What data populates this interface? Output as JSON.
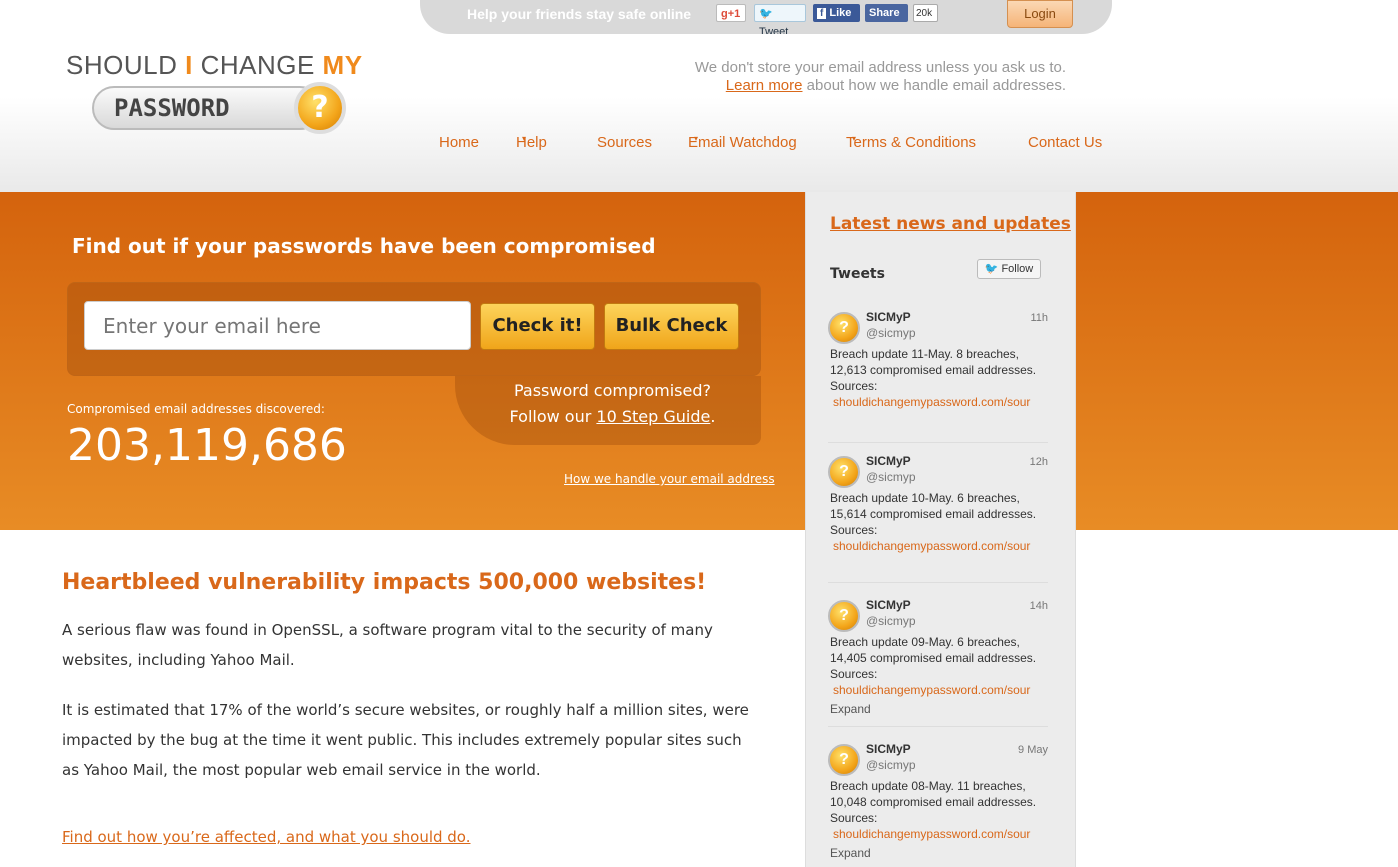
{
  "sharebar": {
    "text": "Help your friends stay safe online",
    "gplus": "g+1",
    "tweet": "Tweet",
    "like": "Like",
    "share": "Share",
    "share_count": "20k",
    "login": "Login"
  },
  "logo": {
    "line1_a": "SHOULD",
    "line1_b": "I",
    "line1_c": "CHANGE",
    "line1_d": "MY",
    "line2": "PASSWORD",
    "badge": "?"
  },
  "privacy": {
    "line1": "We don't store your email address unless you ask us to.",
    "link": "Learn more",
    "line2_rest": " about how we handle email addresses."
  },
  "nav": {
    "items": [
      {
        "label": "Home"
      },
      {
        "label": "Help",
        "dropdown": true
      },
      {
        "label": "Sources"
      },
      {
        "label": "Email Watchdog",
        "dropdown": true
      },
      {
        "label": "Terms & Conditions",
        "dropdown": true
      },
      {
        "label": "Contact Us"
      }
    ],
    "caret": "▾"
  },
  "hero": {
    "title": "Find out if your passwords have been compromised",
    "email_placeholder": "Enter your email here",
    "check_button": "Check it!",
    "bulk_button": "Bulk Check",
    "pw_line1": "Password compromised?",
    "pw_line2_pre": "Follow our ",
    "pw_link": "10 Step Guide",
    "pw_line2_post": ".",
    "discovered_label": "Compromised email addresses discovered:",
    "discovered_count": "203,119,686",
    "handle_link": "How we handle your email address"
  },
  "sidebar": {
    "title": "Latest news and updates",
    "tweets_heading": "Tweets",
    "follow": "Follow",
    "tweets": [
      {
        "name": "SICMyP",
        "handle": "@sicmyp",
        "time": "11h",
        "text": "Breach update 11-May.   8 breaches, 12,613 compromised email addresses. Sources:",
        "link": "shouldichangemypassword.com/sour",
        "expand": ""
      },
      {
        "name": "SICMyP",
        "handle": "@sicmyp",
        "time": "12h",
        "text": "Breach update 10-May.   6 breaches, 15,614 compromised email addresses. Sources:",
        "link": "shouldichangemypassword.com/sour",
        "expand": ""
      },
      {
        "name": "SICMyP",
        "handle": "@sicmyp",
        "time": "14h",
        "text": "Breach update 09-May.   6 breaches, 14,405 compromised email addresses. Sources:",
        "link": "shouldichangemypassword.com/sour",
        "expand": "Expand"
      },
      {
        "name": "SICMyP",
        "handle": "@sicmyp",
        "time": "9 May",
        "text": "Breach update 08-May.   11 breaches, 10,048 compromised email addresses. Sources:",
        "link": "shouldichangemypassword.com/sour",
        "expand": "Expand"
      }
    ]
  },
  "article": {
    "title": "Heartbleed vulnerability impacts 500,000 websites!",
    "p1": "A serious flaw was found in OpenSSL, a software program vital to the security of many websites, including Yahoo Mail.",
    "p2": "It is estimated that 17% of the world’s secure websites, or roughly half a million sites, were impacted by the bug at the time it went public. This includes extremely popular sites such as Yahoo Mail, the most popular web email service in the world.",
    "link": "Find out how you’re affected, and what you should do."
  },
  "colors": {
    "accent": "#d9681a",
    "band_top": "#d4630d",
    "band_bottom": "#e88c25",
    "button": "#f0a51a"
  }
}
